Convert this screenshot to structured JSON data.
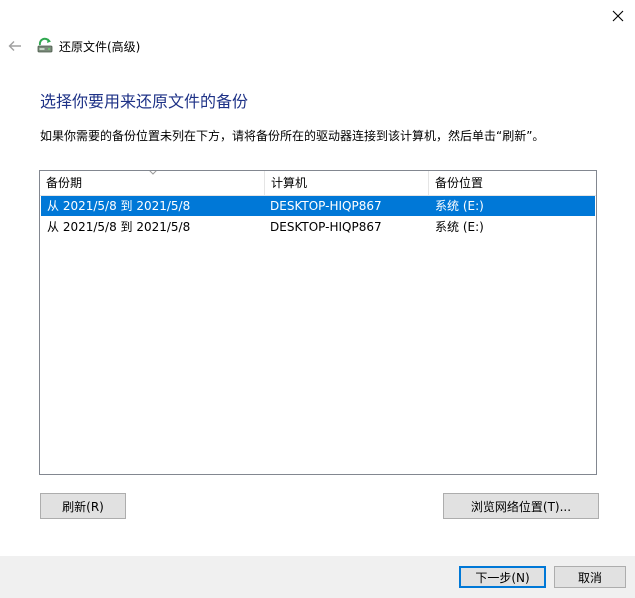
{
  "window": {
    "title": "还原文件(高级)",
    "close_glyph": "✕",
    "back_glyph": "←"
  },
  "page": {
    "heading": "选择你要用来还原文件的备份",
    "instruction": "如果你需要的备份位置未列在下方，请将备份所在的驱动器连接到该计算机，然后单击“刷新”。"
  },
  "table": {
    "columns": [
      "备份期",
      "计算机",
      "备份位置"
    ],
    "rows": [
      {
        "period": "从 2021/5/8 到 2021/5/8",
        "computer": "DESKTOP-HIQP867",
        "location": "系统 (E:)",
        "selected": true
      },
      {
        "period": "从 2021/5/8 到 2021/5/8",
        "computer": "DESKTOP-HIQP867",
        "location": "系统 (E:)",
        "selected": false
      }
    ]
  },
  "buttons": {
    "refresh": "刷新(R)",
    "browse": "浏览网络位置(T)...",
    "next": "下一步(N)",
    "cancel": "取消"
  },
  "colors": {
    "heading": "#1e3287",
    "selection": "#0078d7",
    "footer": "#f0f0f0"
  },
  "icons": {
    "app": "backup-restore-icon",
    "back": "back-arrow-icon",
    "close": "close-icon",
    "sort": "sort-descending-icon"
  }
}
